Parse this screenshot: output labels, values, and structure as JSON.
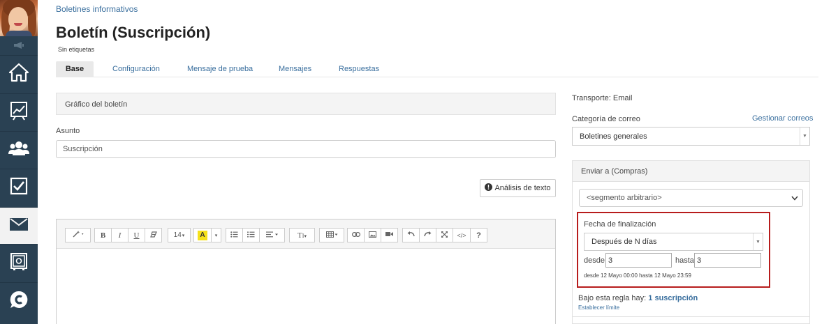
{
  "sidebar": {
    "items": [
      {
        "name": "home-icon"
      },
      {
        "name": "chart-icon"
      },
      {
        "name": "users-icon"
      },
      {
        "name": "checkbox-icon"
      },
      {
        "name": "mail-icon"
      },
      {
        "name": "safe-icon"
      },
      {
        "name": "chat-icon"
      }
    ],
    "active_index": 4
  },
  "breadcrumb": "Boletines informativos",
  "page": {
    "title": "Boletín (Suscripción)",
    "tags": "Sin etiquetas"
  },
  "tabs": [
    "Base",
    "Configuración",
    "Mensaje de prueba",
    "Mensajes",
    "Respuestas"
  ],
  "main": {
    "graphic_header": "Gráfico del boletín",
    "subject_label": "Asunto",
    "subject_value": "Suscripción",
    "analysis_button": "Análisis de texto",
    "toolbar": {
      "font_size": "14",
      "buttons": [
        "magic-icon",
        "bold",
        "italic",
        "underline",
        "eraser",
        "font-size",
        "highlight",
        "bullet-list",
        "number-list",
        "align",
        "text-style",
        "table",
        "link",
        "image",
        "video",
        "undo",
        "redo",
        "fullscreen",
        "code",
        "help"
      ]
    }
  },
  "right": {
    "transport": "Transporte: Email",
    "category_label": "Categoría de correo",
    "manage_link": "Gestionar correos",
    "category_value": "Boletines generales",
    "send_to_header": "Enviar a (Compras)",
    "segment_value": "<segmento arbitrario>",
    "end_date_label": "Fecha de finalización",
    "end_date_value": "Después de N días",
    "from_label": "desde",
    "from_value": "3",
    "to_label": "hasta",
    "to_value": "3",
    "range_text": "desde 12 Mayo 00:00 hasta 12 Mayo 23:59",
    "rule_text": "Bajo esta regla hay:",
    "rule_count": "1 suscripción",
    "set_limit": "Establecer límite"
  },
  "colors": {
    "sidebar": "#2a4153",
    "link": "#3a6f9e",
    "highlight_box": "#b71c1c",
    "highlight_yellow": "#f5e11b"
  }
}
